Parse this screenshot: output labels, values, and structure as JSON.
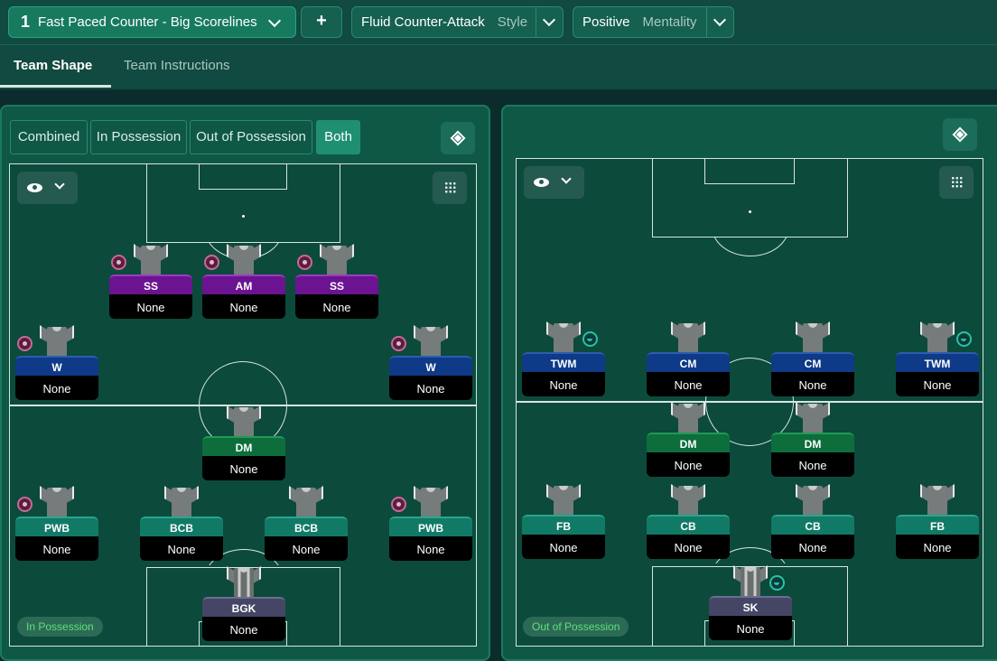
{
  "header": {
    "tactic_number": "1",
    "tactic_name": "Fast Paced Counter - Big Scorelines",
    "add_label": "+",
    "style_value": "Fluid Counter-Attack",
    "style_key": "Style",
    "mentality_value": "Positive",
    "mentality_key": "Mentality"
  },
  "tabs": [
    {
      "label": "Team Shape",
      "active": true
    },
    {
      "label": "Team Instructions",
      "active": false
    }
  ],
  "left_panel": {
    "segments": [
      "Combined",
      "In Possession",
      "Out of Possession",
      "Both"
    ],
    "active_segment": "Both",
    "phase_label": "In Possession",
    "players": [
      {
        "role": "SS",
        "duty": "None",
        "color": "purple",
        "badge": "ball"
      },
      {
        "role": "AM",
        "duty": "None",
        "color": "purple",
        "badge": "ball"
      },
      {
        "role": "SS",
        "duty": "None",
        "color": "purple",
        "badge": "ball"
      },
      {
        "role": "W",
        "duty": "None",
        "color": "blue",
        "badge": "ball"
      },
      {
        "role": "W",
        "duty": "None",
        "color": "blue",
        "badge": "ball"
      },
      {
        "role": "DM",
        "duty": "None",
        "color": "green",
        "badge": ""
      },
      {
        "role": "PWB",
        "duty": "None",
        "color": "teal",
        "badge": "ball"
      },
      {
        "role": "BCB",
        "duty": "None",
        "color": "teal",
        "badge": ""
      },
      {
        "role": "BCB",
        "duty": "None",
        "color": "teal",
        "badge": ""
      },
      {
        "role": "PWB",
        "duty": "None",
        "color": "teal",
        "badge": "ball"
      },
      {
        "role": "BGK",
        "duty": "None",
        "color": "gray",
        "badge": ""
      }
    ]
  },
  "right_panel": {
    "phase_label": "Out of Possession",
    "players": [
      {
        "role": "TWM",
        "duty": "None",
        "color": "blue",
        "badge": "tackle"
      },
      {
        "role": "CM",
        "duty": "None",
        "color": "blue",
        "badge": ""
      },
      {
        "role": "CM",
        "duty": "None",
        "color": "blue",
        "badge": ""
      },
      {
        "role": "TWM",
        "duty": "None",
        "color": "blue",
        "badge": "tackle"
      },
      {
        "role": "DM",
        "duty": "None",
        "color": "green",
        "badge": ""
      },
      {
        "role": "DM",
        "duty": "None",
        "color": "green",
        "badge": ""
      },
      {
        "role": "FB",
        "duty": "None",
        "color": "teal",
        "badge": ""
      },
      {
        "role": "CB",
        "duty": "None",
        "color": "teal",
        "badge": ""
      },
      {
        "role": "CB",
        "duty": "None",
        "color": "teal",
        "badge": ""
      },
      {
        "role": "FB",
        "duty": "None",
        "color": "teal",
        "badge": ""
      },
      {
        "role": "SK",
        "duty": "None",
        "color": "gray",
        "badge": "tackle"
      }
    ]
  },
  "icons": [
    "chevron-down-icon",
    "plus-icon",
    "eye-icon",
    "grid-icon",
    "diamond-icon",
    "ball-icon",
    "tackle-icon",
    "shirt-icon"
  ],
  "colors": {
    "purple": "#6b1390",
    "blue": "#0e3a87",
    "green": "#0d6e3c",
    "teal": "#117a66",
    "gray": "#454665",
    "accent": "#177a5e"
  }
}
